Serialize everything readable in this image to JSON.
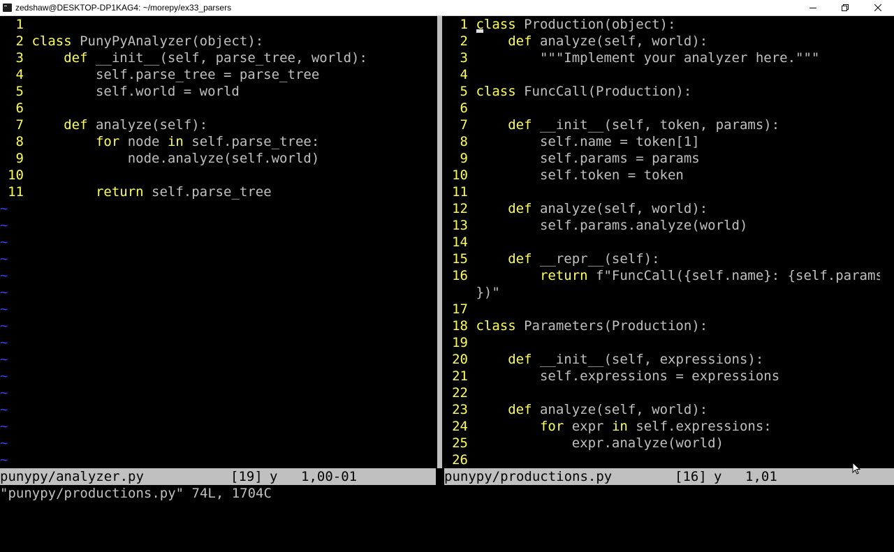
{
  "window": {
    "title": "zedshaw@DESKTOP-DP1KAG4: ~/morepy/ex33_parsers"
  },
  "left_pane": {
    "lines": [
      {
        "n": "1",
        "parts": []
      },
      {
        "n": "2",
        "parts": [
          {
            "t": "class",
            "c": "k-class"
          },
          {
            "t": " PunyPyAnalyzer(object):"
          }
        ]
      },
      {
        "n": "3",
        "parts": [
          {
            "t": "    "
          },
          {
            "t": "def",
            "c": "k-def"
          },
          {
            "t": " __init__(self, parse_tree, world):"
          }
        ]
      },
      {
        "n": "4",
        "parts": [
          {
            "t": "        self.parse_tree = parse_tree"
          }
        ]
      },
      {
        "n": "5",
        "parts": [
          {
            "t": "        self.world = world"
          }
        ]
      },
      {
        "n": "6",
        "parts": []
      },
      {
        "n": "7",
        "parts": [
          {
            "t": "    "
          },
          {
            "t": "def",
            "c": "k-def"
          },
          {
            "t": " analyze(self):"
          }
        ]
      },
      {
        "n": "8",
        "parts": [
          {
            "t": "        "
          },
          {
            "t": "for",
            "c": "k-for"
          },
          {
            "t": " node "
          },
          {
            "t": "in",
            "c": "k-in"
          },
          {
            "t": " self.parse_tree:"
          }
        ]
      },
      {
        "n": "9",
        "parts": [
          {
            "t": "            node.analyze(self.world)"
          }
        ]
      },
      {
        "n": "10",
        "parts": []
      },
      {
        "n": "11",
        "parts": [
          {
            "t": "        "
          },
          {
            "t": "return",
            "c": "k-return"
          },
          {
            "t": " self.parse_tree"
          }
        ]
      }
    ],
    "tilde": "~",
    "tilde_count": 16
  },
  "right_pane": {
    "lines": [
      {
        "n": "1",
        "parts": [
          {
            "t": "class",
            "c": "k-class"
          },
          {
            "t": " Production(object):"
          }
        ]
      },
      {
        "n": "2",
        "parts": [
          {
            "t": "    "
          },
          {
            "t": "def",
            "c": "k-def"
          },
          {
            "t": " analyze(self, world):"
          }
        ]
      },
      {
        "n": "3",
        "parts": [
          {
            "t": "        \"\"\"Implement your analyzer here.\"\"\""
          }
        ]
      },
      {
        "n": "4",
        "parts": []
      },
      {
        "n": "5",
        "parts": [
          {
            "t": "class",
            "c": "k-class"
          },
          {
            "t": " FuncCall(Production):"
          }
        ]
      },
      {
        "n": "6",
        "parts": []
      },
      {
        "n": "7",
        "parts": [
          {
            "t": "    "
          },
          {
            "t": "def",
            "c": "k-def"
          },
          {
            "t": " __init__(self, token, params):"
          }
        ]
      },
      {
        "n": "8",
        "parts": [
          {
            "t": "        self.name = token[1]"
          }
        ]
      },
      {
        "n": "9",
        "parts": [
          {
            "t": "        self.params = params"
          }
        ]
      },
      {
        "n": "10",
        "parts": [
          {
            "t": "        self.token = token"
          }
        ]
      },
      {
        "n": "11",
        "parts": []
      },
      {
        "n": "12",
        "parts": [
          {
            "t": "    "
          },
          {
            "t": "def",
            "c": "k-def"
          },
          {
            "t": " analyze(self, world):"
          }
        ]
      },
      {
        "n": "13",
        "parts": [
          {
            "t": "        self.params.analyze(world)"
          }
        ]
      },
      {
        "n": "14",
        "parts": []
      },
      {
        "n": "15",
        "parts": [
          {
            "t": "    "
          },
          {
            "t": "def",
            "c": "k-def"
          },
          {
            "t": " __repr__(self):"
          }
        ]
      },
      {
        "n": "16",
        "parts": [
          {
            "t": "        "
          },
          {
            "t": "return",
            "c": "k-return"
          },
          {
            "t": " f\"FuncCall({self.name}: {self.params"
          }
        ]
      },
      {
        "n": "",
        "parts": [
          {
            "t": "})\""
          }
        ]
      },
      {
        "n": "17",
        "parts": []
      },
      {
        "n": "18",
        "parts": [
          {
            "t": "class",
            "c": "k-class"
          },
          {
            "t": " Parameters(Production):"
          }
        ]
      },
      {
        "n": "19",
        "parts": []
      },
      {
        "n": "20",
        "parts": [
          {
            "t": "    "
          },
          {
            "t": "def",
            "c": "k-def"
          },
          {
            "t": " __init__(self, expressions):"
          }
        ]
      },
      {
        "n": "21",
        "parts": [
          {
            "t": "        self.expressions = expressions"
          }
        ]
      },
      {
        "n": "22",
        "parts": []
      },
      {
        "n": "23",
        "parts": [
          {
            "t": "    "
          },
          {
            "t": "def",
            "c": "k-def"
          },
          {
            "t": " analyze(self, world):"
          }
        ]
      },
      {
        "n": "24",
        "parts": [
          {
            "t": "        "
          },
          {
            "t": "for",
            "c": "k-for"
          },
          {
            "t": " expr "
          },
          {
            "t": "in",
            "c": "k-in"
          },
          {
            "t": " self.expressions:"
          }
        ]
      },
      {
        "n": "25",
        "parts": [
          {
            "t": "            expr.analyze(world)"
          }
        ]
      },
      {
        "n": "26",
        "parts": []
      }
    ]
  },
  "status": {
    "left": {
      "file": "punypy/analyzer.py",
      "buf": "[19]",
      "flag": "y",
      "pos": "1,00-01"
    },
    "right": {
      "file": "punypy/productions.py",
      "buf": "[16]",
      "flag": "y",
      "pos": "1,01"
    }
  },
  "command_line": "\"punypy/productions.py\" 74L, 1704C",
  "colors": {
    "background": "#000000",
    "text": "#c0c0c0",
    "line_number": "#ffff55",
    "keyword": "#ffff55",
    "tilde": "#4040ff",
    "status_bar": "#c0c0c0"
  },
  "icons": {
    "minimize": "minimize-icon",
    "maximize": "restore-icon",
    "close": "close-icon",
    "pointer": "mouse-pointer-icon"
  }
}
